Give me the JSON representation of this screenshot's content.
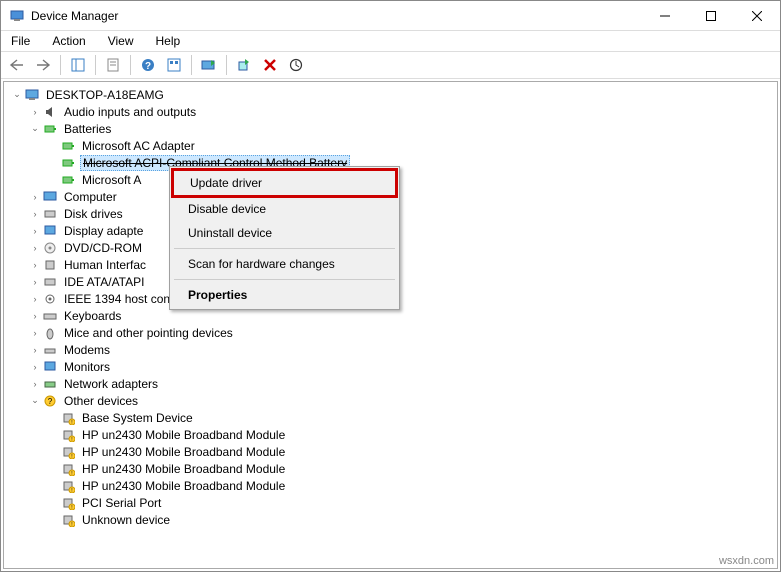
{
  "window": {
    "title": "Device Manager"
  },
  "menu": {
    "file": "File",
    "action": "Action",
    "view": "View",
    "help": "Help"
  },
  "tree": {
    "root": "DESKTOP-A18EAMG",
    "audio": "Audio inputs and outputs",
    "batteries": "Batteries",
    "bat_ac": "Microsoft AC Adapter",
    "bat_acpi": "Microsoft ACPI-Compliant Control Method Battery",
    "bat_ac2": "Microsoft A",
    "computer": "Computer",
    "disk": "Disk drives",
    "display": "Display adapte",
    "dvd": "DVD/CD-ROM",
    "hid": "Human Interfac",
    "ide": "IDE ATA/ATAPI",
    "ieee": "IEEE 1394 host controllers",
    "keyboards": "Keyboards",
    "mice": "Mice and other pointing devices",
    "modems": "Modems",
    "monitors": "Monitors",
    "network": "Network adapters",
    "other": "Other devices",
    "oth_base": "Base System Device",
    "oth_hp1": "HP un2430 Mobile Broadband Module",
    "oth_hp2": "HP un2430 Mobile Broadband Module",
    "oth_hp3": "HP un2430 Mobile Broadband Module",
    "oth_hp4": "HP un2430 Mobile Broadband Module",
    "oth_pci": "PCI Serial Port",
    "oth_unknown": "Unknown device"
  },
  "context": {
    "update": "Update driver",
    "disable": "Disable device",
    "uninstall": "Uninstall device",
    "scan": "Scan for hardware changes",
    "properties": "Properties"
  },
  "watermark": "wsxdn.com"
}
